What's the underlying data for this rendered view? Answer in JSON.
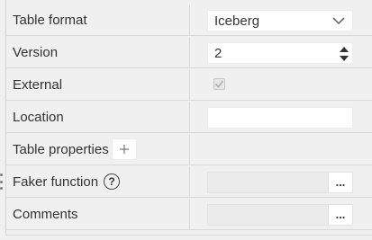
{
  "rows": {
    "table_format": {
      "label": "Table format",
      "value": "Iceberg"
    },
    "version": {
      "label": "Version",
      "value": "2"
    },
    "external": {
      "label": "External",
      "checked": true
    },
    "location": {
      "label": "Location",
      "value": ""
    },
    "table_properties": {
      "label": "Table properties",
      "add_icon": "plus-icon"
    },
    "faker_function": {
      "label": "Faker function",
      "help_symbol": "?",
      "value": "",
      "button_label": "..."
    },
    "comments": {
      "label": "Comments",
      "value": "",
      "button_label": "..."
    }
  },
  "colors": {
    "background": "#f0f0f0",
    "field": "#ffffff",
    "border": "#d9d9d9",
    "text": "#333333"
  }
}
